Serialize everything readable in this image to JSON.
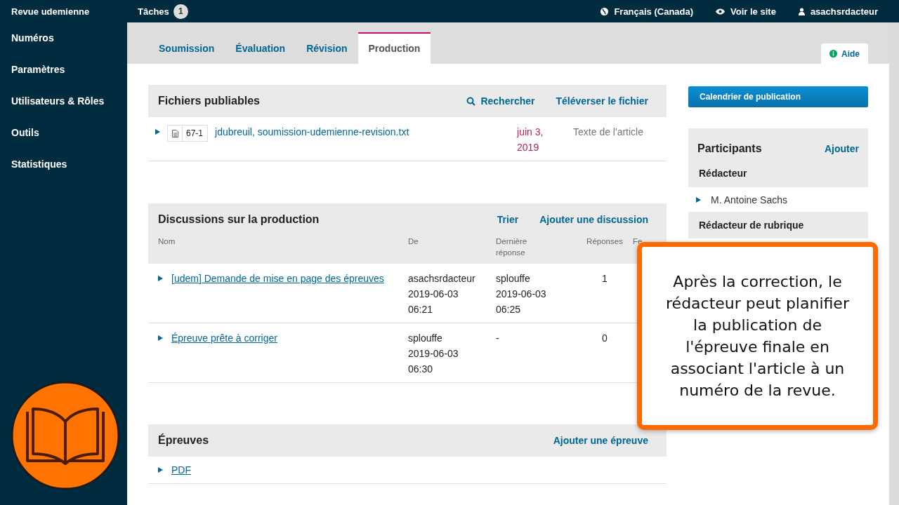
{
  "top_bar": {
    "journal": "Revue udemienne",
    "tasks": {
      "label": "Tâches",
      "count": "1"
    },
    "language": "Français (Canada)",
    "view_site": "Voir le site",
    "user": "asachsrdacteur"
  },
  "sidebar": {
    "items": [
      {
        "label": "Numéros"
      },
      {
        "label": "Paramètres"
      },
      {
        "label": "Utilisateurs & Rôles"
      },
      {
        "label": "Outils"
      },
      {
        "label": "Statistiques"
      }
    ]
  },
  "tabs": [
    {
      "label": "Soumission",
      "selected": false
    },
    {
      "label": "Évaluation",
      "selected": false
    },
    {
      "label": "Révision",
      "selected": false
    },
    {
      "label": "Production",
      "selected": true
    }
  ],
  "help": "Aide",
  "publishable_files": {
    "title": "Fichiers publiables",
    "search": "Rechercher",
    "actions": [
      {
        "label": "Téléverser le fichier"
      }
    ],
    "rows": [
      {
        "id": "67-1",
        "name": "jdubreuil, soumission-udemienne-revision.txt",
        "date": "juin 3, 2019",
        "type": "Texte de l'article"
      }
    ]
  },
  "discussions": {
    "title": "Discussions sur la production",
    "actions": [
      {
        "label": "Trier"
      },
      {
        "label": "Ajouter une discussion"
      }
    ],
    "columns": [
      "Nom",
      "De",
      "Dernière réponse",
      "Réponses",
      "Fe"
    ],
    "rows": [
      {
        "name": "[udem] Demande de mise en page des épreuves",
        "from": [
          "asachsrdacteur",
          "2019-06-03",
          "06:21"
        ],
        "last_reply": [
          "splouffe",
          "2019-06-03",
          "06:25"
        ],
        "replies": "1"
      },
      {
        "name": "Épreuve prête à corriger",
        "from": [
          "splouffe",
          "2019-06-03",
          "06:30"
        ],
        "last_reply": [
          "-"
        ],
        "replies": "0"
      }
    ]
  },
  "proofs": {
    "title": "Épreuves",
    "actions": [
      {
        "label": "Ajouter une épreuve"
      }
    ],
    "rows": [
      {
        "name": "PDF"
      }
    ]
  },
  "schedule_button": "Calendrier de publication",
  "participants": {
    "title": "Participants",
    "add": "Ajouter",
    "groups": [
      {
        "role": "Rédacteur",
        "members": [
          "M. Antoine Sachs"
        ]
      },
      {
        "role": "Rédacteur de rubrique"
      }
    ]
  },
  "callout": {
    "text": "Après la correction, le rédacteur peut planifier la publication de l'épreuve finale en associant l'article à un numéro de la revue."
  }
}
